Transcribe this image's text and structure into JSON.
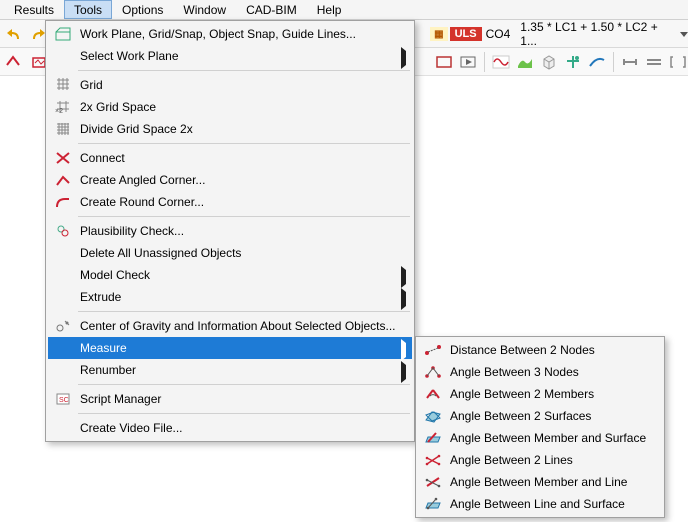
{
  "menubar": {
    "results": "Results",
    "tools": "Tools",
    "options": "Options",
    "window": "Window",
    "cadbim": "CAD-BIM",
    "help": "Help"
  },
  "toolbar_right": {
    "uls": "ULS",
    "co": "CO4",
    "combo": "1.35 * LC1 + 1.50 * LC2 + 1..."
  },
  "tools_menu": {
    "workplane": "Work Plane, Grid/Snap, Object Snap, Guide Lines...",
    "select_workplane": "Select Work Plane",
    "grid": "Grid",
    "grid2x": "2x Grid Space",
    "grid_div2x": "Divide Grid Space 2x",
    "connect": "Connect",
    "angled": "Create Angled Corner...",
    "round": "Create Round Corner...",
    "plaus": "Plausibility Check...",
    "delete_un": "Delete All Unassigned Objects",
    "model_check": "Model Check",
    "extrude": "Extrude",
    "cog": "Center of Gravity and Information About Selected Objects...",
    "measure": "Measure",
    "renumber": "Renumber",
    "script": "Script Manager",
    "video": "Create Video File..."
  },
  "measure_sub": {
    "dist2n": "Distance Between 2 Nodes",
    "ang3n": "Angle Between 3 Nodes",
    "ang2m": "Angle Between 2 Members",
    "ang2s": "Angle Between 2 Surfaces",
    "angms": "Angle Between Member and Surface",
    "ang2l": "Angle Between 2 Lines",
    "angml": "Angle Between Member and Line",
    "angls": "Angle Between Line and Surface"
  }
}
